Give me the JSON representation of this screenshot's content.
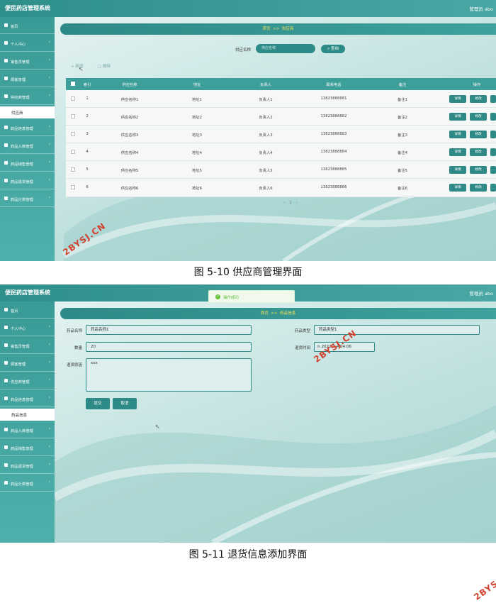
{
  "screen1": {
    "app_title": "便民药店管理系统",
    "user": "管理员 abo",
    "sidebar": [
      {
        "label": "首页"
      },
      {
        "label": "个人中心"
      },
      {
        "label": "销售员管理"
      },
      {
        "label": "顾客管理"
      },
      {
        "label": "供应商管理"
      },
      {
        "label": "供应商",
        "sub": true
      },
      {
        "label": "药品信息管理"
      },
      {
        "label": "药品入库管理"
      },
      {
        "label": "药品销售管理"
      },
      {
        "label": "药品退货管理"
      },
      {
        "label": "药品分类管理"
      }
    ],
    "breadcrumb": {
      "home": "首页",
      "sep": ">>",
      "current": "供应商"
    },
    "search": {
      "label": "供应名称",
      "placeholder": "供应名称",
      "button": "查询"
    },
    "toolbar": {
      "add": "+ 新增",
      "delete": "删除"
    },
    "table": {
      "headers": [
        "索引",
        "供应名称",
        "地址",
        "负责人",
        "联系电话",
        "备注",
        "操作"
      ],
      "rows": [
        {
          "index": "1",
          "name": "供应名称1",
          "address": "地址1",
          "person": "负责人1",
          "phone": "13823888881",
          "remark": "备注1"
        },
        {
          "index": "2",
          "name": "供应名称2",
          "address": "地址2",
          "person": "负责人2",
          "phone": "13823888882",
          "remark": "备注2"
        },
        {
          "index": "3",
          "name": "供应名称3",
          "address": "地址3",
          "person": "负责人3",
          "phone": "13823888883",
          "remark": "备注3"
        },
        {
          "index": "4",
          "name": "供应名称4",
          "address": "地址4",
          "person": "负责人4",
          "phone": "13823888884",
          "remark": "备注4"
        },
        {
          "index": "5",
          "name": "供应名称5",
          "address": "地址5",
          "person": "负责人5",
          "phone": "13823888885",
          "remark": "备注5"
        },
        {
          "index": "6",
          "name": "供应名称6",
          "address": "地址6",
          "person": "负责人6",
          "phone": "13823888886",
          "remark": "备注6"
        }
      ],
      "actions": [
        "详情",
        "修改"
      ]
    },
    "pager": {
      "prev": "‹",
      "page": "1",
      "next": "›"
    }
  },
  "caption1": "图 5-10 供应商管理界面",
  "screen2": {
    "app_title": "便民药店管理系统",
    "user": "管理员 abo",
    "toast": "操作成功",
    "sidebar": [
      {
        "label": "首页"
      },
      {
        "label": "个人中心"
      },
      {
        "label": "销售员管理"
      },
      {
        "label": "顾客管理"
      },
      {
        "label": "供应商管理"
      },
      {
        "label": "药品信息管理"
      },
      {
        "label": "药品信息",
        "sub": true
      },
      {
        "label": "药品入库管理"
      },
      {
        "label": "药品销售管理"
      },
      {
        "label": "药品退货管理"
      },
      {
        "label": "药品分类管理"
      }
    ],
    "breadcrumb": {
      "home": "首页",
      "sep": ">>",
      "current": "药品信息"
    },
    "form": {
      "name_label": "药品名称",
      "name_value": "药品名称1",
      "type_label": "药品类型",
      "type_value": "药品类型1",
      "qty_label": "数量",
      "qty_value": "20",
      "time_label": "退货时间",
      "time_value": "2022-0   4:04:06",
      "reason_label": "退货原因",
      "reason_value": "xxx",
      "submit": "提交",
      "cancel": "取消"
    }
  },
  "caption2": "图 5-11 退货信息添加界面",
  "watermark": "2BYSJ.CN",
  "colors": {
    "accent": "#2e8a86",
    "watermark": "#d2412f",
    "breadcrumb_text": "#f5e25a"
  }
}
